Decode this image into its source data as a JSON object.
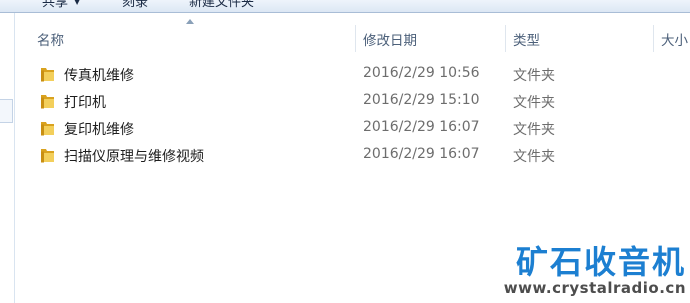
{
  "toolbar": {
    "share_label": "共享",
    "burn_label": "刻录",
    "new_folder_label": "新建文件夹"
  },
  "columns": {
    "name": "名称",
    "date": "修改日期",
    "type": "类型",
    "size": "大小"
  },
  "files": [
    {
      "name": "传真机维修",
      "date": "2016/2/29 10:56",
      "type": "文件夹",
      "icon": "folder-icon"
    },
    {
      "name": "打印机",
      "date": "2016/2/29 15:10",
      "type": "文件夹",
      "icon": "folder-icon"
    },
    {
      "name": "复印机维修",
      "date": "2016/2/29 16:07",
      "type": "文件夹",
      "icon": "folder-icon"
    },
    {
      "name": "扫描仪原理与维修视频",
      "date": "2016/2/29 16:07",
      "type": "文件夹",
      "icon": "folder-icon"
    }
  ],
  "watermark": {
    "chinese": "矿石收音机",
    "url": "www.crystalradio.cn"
  },
  "colors": {
    "folder": "#e8b733",
    "watermark_blue": "#1c7fd1",
    "header_text": "#4c607a"
  }
}
